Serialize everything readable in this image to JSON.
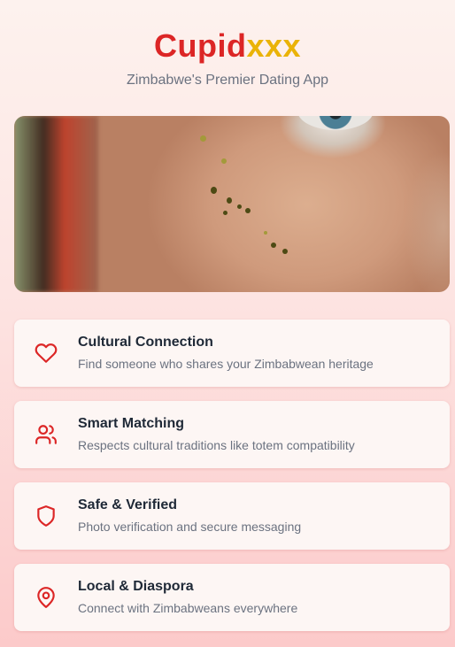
{
  "brand": {
    "logo_part_1": "Cupid",
    "logo_part_2": "xxx",
    "tagline": "Zimbabwe's Premier Dating App"
  },
  "hero_image": {
    "description_icon": "hero-photo"
  },
  "features": [
    {
      "icon": "heart-icon",
      "title": "Cultural Connection",
      "description": "Find someone who shares your Zimbabwean heritage"
    },
    {
      "icon": "users-icon",
      "title": "Smart Matching",
      "description": "Respects cultural traditions like totem compatibility"
    },
    {
      "icon": "shield-icon",
      "title": "Safe & Verified",
      "description": "Photo verification and secure messaging"
    },
    {
      "icon": "map-pin-icon",
      "title": "Local & Diaspora",
      "description": "Connect with Zimbabweans everywhere"
    }
  ],
  "colors": {
    "brand_red": "#dc2626",
    "brand_gold": "#eab308",
    "icon_color": "#dc2626"
  }
}
